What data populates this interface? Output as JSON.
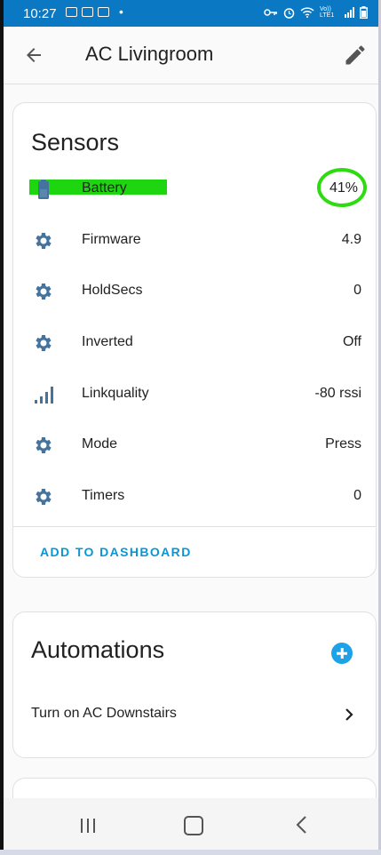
{
  "status_bar": {
    "time": "10:27",
    "volte_label": "Vo)) LTE1",
    "icons": [
      "gallery-icon",
      "gmail-icon",
      "photos-icon",
      "key-icon",
      "alarm-icon",
      "wifi-icon",
      "signal-icon",
      "battery-icon"
    ]
  },
  "header": {
    "title": "AC Livingroom"
  },
  "sensors": {
    "title": "Sensors",
    "items": [
      {
        "label": "Battery",
        "value": "41%",
        "icon": "battery-icon"
      },
      {
        "label": "Firmware",
        "value": "4.9",
        "icon": "gear-icon"
      },
      {
        "label": "HoldSecs",
        "value": "0",
        "icon": "gear-icon"
      },
      {
        "label": "Inverted",
        "value": "Off",
        "icon": "gear-icon"
      },
      {
        "label": "Linkquality",
        "value": "-80 rssi",
        "icon": "signal-icon"
      },
      {
        "label": "Mode",
        "value": "Press",
        "icon": "gear-icon"
      },
      {
        "label": "Timers",
        "value": "0",
        "icon": "gear-icon"
      }
    ],
    "action_label": "ADD TO DASHBOARD"
  },
  "automations": {
    "title": "Automations",
    "items": [
      {
        "label": "Turn on AC Downstairs"
      }
    ]
  },
  "colors": {
    "accent": "#0797d6",
    "status_bar": "#0a78c2",
    "icon": "#44739e",
    "highlight": "#1ed610"
  }
}
